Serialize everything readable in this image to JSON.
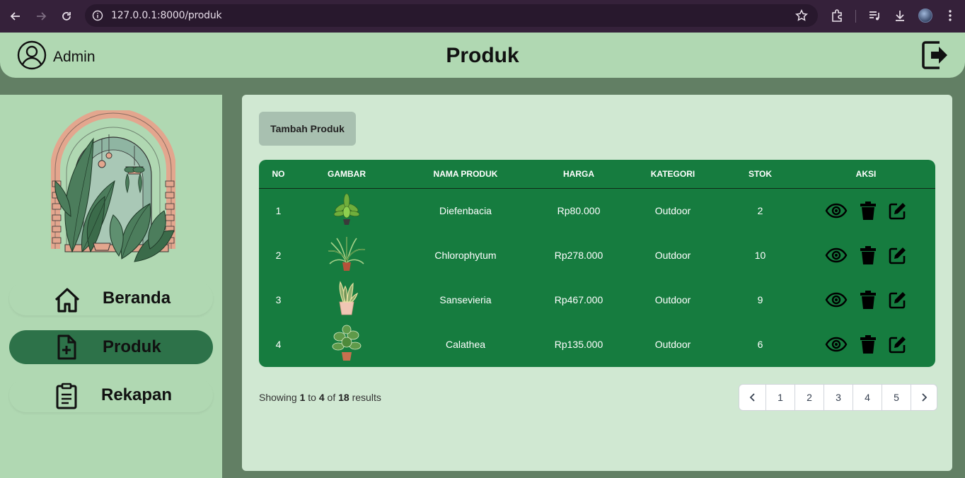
{
  "browser": {
    "url": "127.0.0.1:8000/produk"
  },
  "header": {
    "user_name": "Admin",
    "title": "Produk"
  },
  "sidebar": {
    "items": [
      {
        "label": "Beranda",
        "icon": "home-icon",
        "active": false
      },
      {
        "label": "Produk",
        "icon": "file-plus-icon",
        "active": true
      },
      {
        "label": "Rekapan",
        "icon": "clipboard-icon",
        "active": false
      }
    ]
  },
  "main": {
    "add_button": "Tambah Produk",
    "table": {
      "columns": [
        "NO",
        "GAMBAR",
        "NAMA PRODUK",
        "HARGA",
        "KATEGORI",
        "STOK",
        "AKSI"
      ],
      "rows": [
        {
          "no": "1",
          "image": "diefenbacia-plant",
          "name": "Diefenbacia",
          "price": "Rp80.000",
          "category": "Outdoor",
          "stock": "2"
        },
        {
          "no": "2",
          "image": "chlorophytum-plant",
          "name": "Chlorophytum",
          "price": "Rp278.000",
          "category": "Outdoor",
          "stock": "10"
        },
        {
          "no": "3",
          "image": "sansevieria-plant",
          "name": "Sansevieria",
          "price": "Rp467.000",
          "category": "Outdoor",
          "stock": "9"
        },
        {
          "no": "4",
          "image": "calathea-plant",
          "name": "Calathea",
          "price": "Rp135.000",
          "category": "Outdoor",
          "stock": "6"
        }
      ]
    },
    "pagination": {
      "showing_prefix": "Showing",
      "from": "1",
      "to_word": "to",
      "to": "4",
      "of_word": "of",
      "total": "18",
      "suffix": "results",
      "pages": [
        "1",
        "2",
        "3",
        "4",
        "5"
      ]
    }
  },
  "colors": {
    "page_bg": "#627f64",
    "header_bg": "#b0d8b2",
    "panel_bg": "#d0e8d2",
    "table_bg": "#167c3f",
    "active_menu": "#2d7249"
  }
}
